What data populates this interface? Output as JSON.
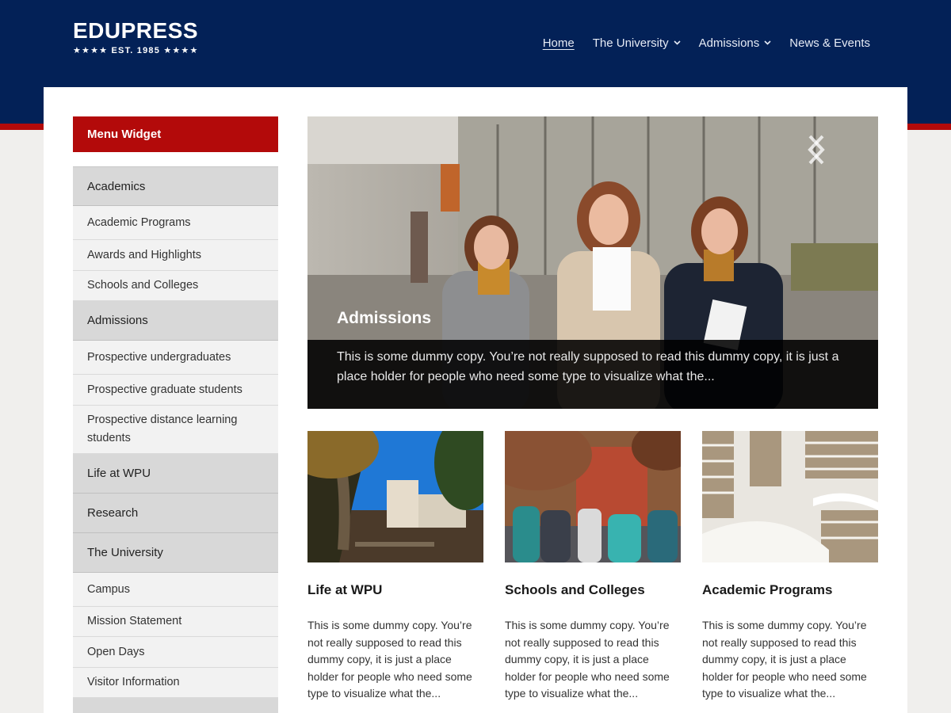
{
  "brand": {
    "title": "EDUPRESS",
    "subtitle": "★★★★  EST. 1985  ★★★★"
  },
  "nav": {
    "items": [
      {
        "label": "Home",
        "active": true,
        "dropdown": false
      },
      {
        "label": "The University",
        "active": false,
        "dropdown": true
      },
      {
        "label": "Admissions",
        "active": false,
        "dropdown": true
      },
      {
        "label": "News & Events",
        "active": false,
        "dropdown": false
      }
    ]
  },
  "sidebar": {
    "title": "Menu Widget",
    "items": [
      {
        "label": "Academics",
        "type": "head"
      },
      {
        "label": "Academic Programs",
        "type": "sub"
      },
      {
        "label": "Awards and Highlights",
        "type": "sub"
      },
      {
        "label": "Schools and Colleges",
        "type": "sub"
      },
      {
        "label": "Admissions",
        "type": "head"
      },
      {
        "label": "Prospective undergraduates",
        "type": "sub"
      },
      {
        "label": "Prospective graduate students",
        "type": "sub"
      },
      {
        "label": "Prospective distance learning students",
        "type": "sub"
      },
      {
        "label": "Life at WPU",
        "type": "head"
      },
      {
        "label": "Research",
        "type": "head"
      },
      {
        "label": "The University",
        "type": "head"
      },
      {
        "label": "Campus",
        "type": "sub"
      },
      {
        "label": "Mission Statement",
        "type": "sub"
      },
      {
        "label": "Open Days",
        "type": "sub"
      },
      {
        "label": "Visitor Information",
        "type": "sub"
      }
    ]
  },
  "hero": {
    "title": "Admissions",
    "text": "This is some dummy copy. You’re not really supposed to read this dummy copy, it is just a place holder for people who need some type to visualize what the..."
  },
  "cards": [
    {
      "title": "Life at WPU",
      "text": "This is some dummy copy. You’re not really supposed to read this dummy copy, it is just a place holder for people who need some type to visualize what the..."
    },
    {
      "title": "Schools and Colleges",
      "text": "This is some dummy copy. You’re not really supposed to read this dummy copy, it is just a place holder for people who need some type to visualize what the..."
    },
    {
      "title": "Academic Programs",
      "text": "This is some dummy copy. You’re not really supposed to read this dummy copy, it is just a place holder for people who need some type to visualize what the..."
    }
  ],
  "colors": {
    "header": "#032157",
    "accent": "#b30a0a",
    "sidebar_head": "#d8d8d8",
    "sidebar_sub": "#f2f2f2"
  }
}
